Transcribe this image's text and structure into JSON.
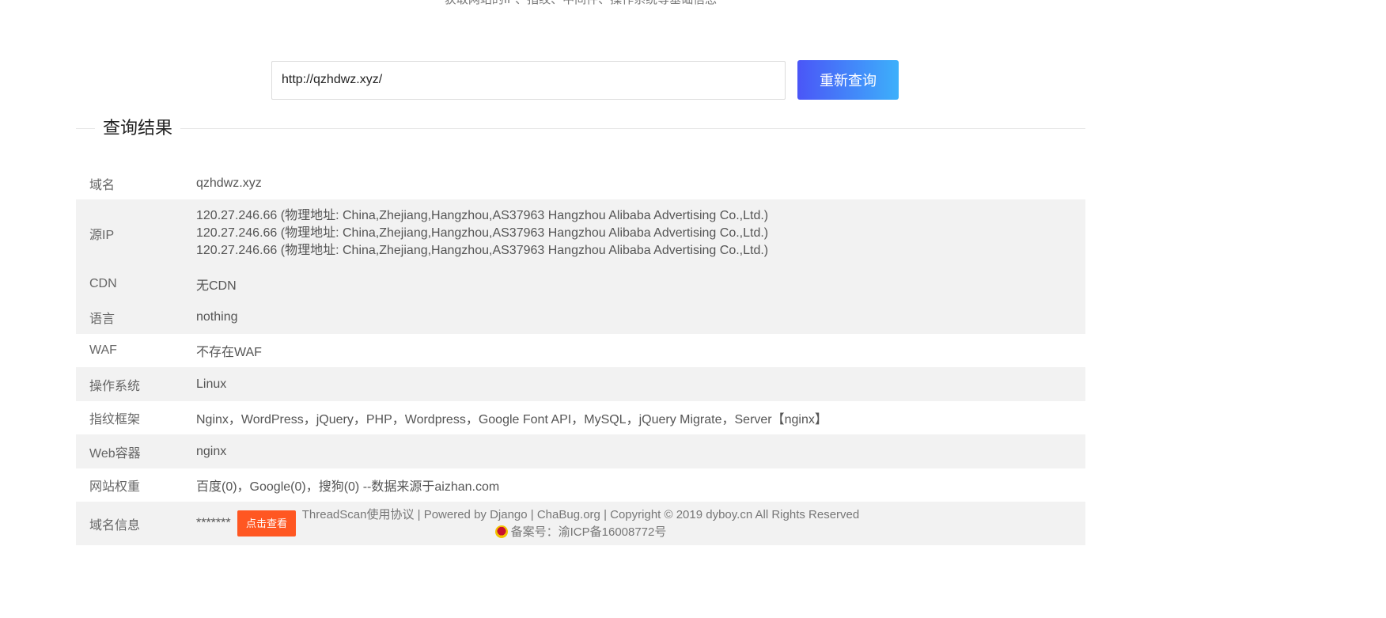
{
  "header": {
    "subtitle": "获取网站的IP、指纹、中间件、操作系统等基础信息"
  },
  "search": {
    "value": "http://qzhdwz.xyz/",
    "button_label": "重新查询"
  },
  "section": {
    "title": "查询结果"
  },
  "results": {
    "domain": {
      "label": "域名",
      "value": "qzhdwz.xyz"
    },
    "source_ip": {
      "label": "源IP",
      "lines": [
        "120.27.246.66 (物理地址: China,Zhejiang,Hangzhou,AS37963 Hangzhou Alibaba Advertising Co.,Ltd.)",
        "120.27.246.66 (物理地址: China,Zhejiang,Hangzhou,AS37963 Hangzhou Alibaba Advertising Co.,Ltd.)",
        "120.27.246.66 (物理地址: China,Zhejiang,Hangzhou,AS37963 Hangzhou Alibaba Advertising Co.,Ltd.)"
      ]
    },
    "cdn": {
      "label": "CDN",
      "value": "无CDN"
    },
    "language": {
      "label": "语言",
      "value": "nothing"
    },
    "waf": {
      "label": "WAF",
      "value": "不存在WAF"
    },
    "os": {
      "label": "操作系统",
      "value": "Linux"
    },
    "fingerprint": {
      "label": "指纹框架",
      "value": "Nginx，WordPress，jQuery，PHP，Wordpress，Google Font API，MySQL，jQuery Migrate，Server【nginx】"
    },
    "web_container": {
      "label": "Web容器",
      "value": "nginx"
    },
    "site_weight": {
      "label": "网站权重",
      "value": "百度(0)，Google(0)，搜狗(0) --数据来源于aizhan.com"
    },
    "domain_info": {
      "label": "域名信息",
      "value": "*******",
      "button_label": "点击查看"
    }
  },
  "footer": {
    "links_line": "ThreadScan使用协议 | Powered by Django | ChaBug.org | Copyright © 2019 dyboy.cn All Rights Reserved",
    "icp_line": "备案号：渝ICP备16008772号",
    "icp_icon": "police-badge-icon"
  }
}
